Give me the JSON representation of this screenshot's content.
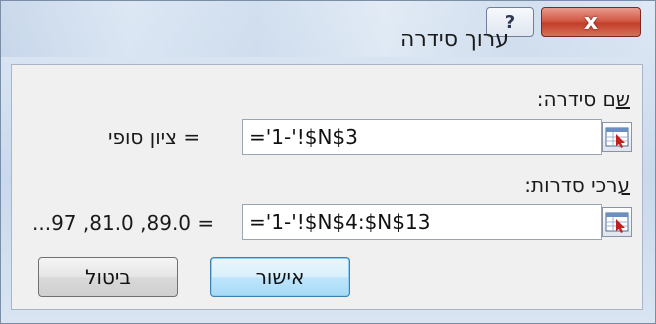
{
  "dialog": {
    "title": "ערוך סידרה",
    "help_glyph": "?",
    "close_glyph": "x"
  },
  "series_name": {
    "label_underlined": "ש",
    "label_rest": "ם סידרה:",
    "value": "='1-'!$N$3",
    "preview": "= ציון סופי"
  },
  "series_values": {
    "label_underlined": "ע",
    "label_rest": "רכי סדרות:",
    "value": "='1-'!$N$4:$N$13",
    "preview": "= 89.0, 81.0, 97..."
  },
  "buttons": {
    "ok": "אישור",
    "cancel": "ביטול"
  },
  "colors": {
    "close": "#c8462f",
    "default_button": "#bee6fd",
    "frame": "#c9d9ec"
  }
}
